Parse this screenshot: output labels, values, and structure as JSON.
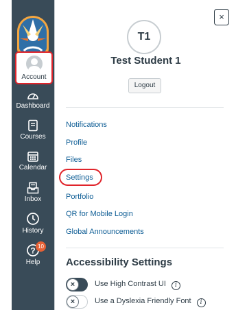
{
  "colors": {
    "nav_background": "#394b58",
    "accent_link": "#0c5c94",
    "highlight_ring": "#e0242b",
    "badge": "#e66135"
  },
  "nav": {
    "account": {
      "label": "Account",
      "icon": "user-avatar-icon"
    },
    "items": [
      {
        "label": "Dashboard",
        "icon": "dashboard-icon"
      },
      {
        "label": "Courses",
        "icon": "courses-book-icon"
      },
      {
        "label": "Calendar",
        "icon": "calendar-icon"
      },
      {
        "label": "Inbox",
        "icon": "inbox-icon"
      },
      {
        "label": "History",
        "icon": "history-clock-icon"
      },
      {
        "label": "Help",
        "icon": "help-question-icon",
        "badge": "10"
      }
    ]
  },
  "tray": {
    "close_glyph": "×",
    "avatar_initials": "T1",
    "user_name": "Test Student 1",
    "logout_label": "Logout",
    "links": [
      "Notifications",
      "Profile",
      "Files",
      "Settings",
      "Portfolio",
      "QR for Mobile Login",
      "Global Announcements"
    ],
    "accessibility": {
      "title": "Accessibility Settings",
      "high_contrast": {
        "label": "Use High Contrast UI",
        "knob": "×",
        "info": "i"
      },
      "dyslexia_font": {
        "label": "Use a Dyslexia Friendly Font",
        "knob": "×",
        "info": "i"
      }
    }
  }
}
